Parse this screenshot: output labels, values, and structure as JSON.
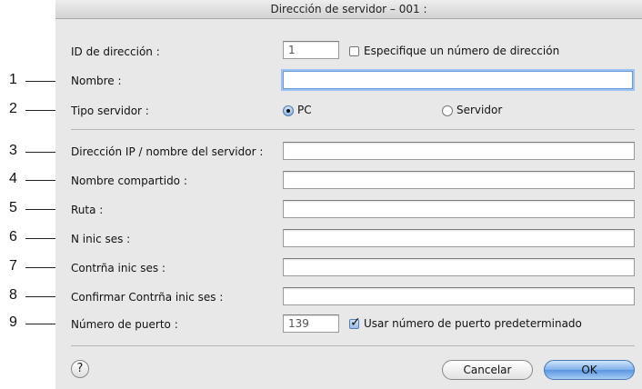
{
  "dialog": {
    "title": "Dirección de servidor – 001 :",
    "address_id": {
      "label": "ID de dirección :",
      "value": "1",
      "specify_checkbox_label": "Especifique un número de dirección",
      "specify_checked": false
    },
    "name": {
      "label": "Nombre :",
      "value": ""
    },
    "server_type": {
      "label": "Tipo servidor :",
      "options": [
        "PC",
        "Servidor"
      ],
      "selected": "PC"
    },
    "ip_server_name": {
      "label": "Dirección IP / nombre del servidor :",
      "value": ""
    },
    "shared_name": {
      "label": "Nombre compartido :",
      "value": ""
    },
    "path": {
      "label": "Ruta :",
      "value": ""
    },
    "login_name": {
      "label": "N inic ses :",
      "value": ""
    },
    "login_password": {
      "label": "Contrña inic ses :",
      "value": ""
    },
    "confirm_password": {
      "label": "Confirmar Contrña inic ses :",
      "value": ""
    },
    "port": {
      "label": "Número de puerto :",
      "value": "139",
      "default_checkbox_label": "Usar número de puerto predeterminado",
      "default_checked": true
    },
    "buttons": {
      "help": "?",
      "cancel": "Cancelar",
      "ok": "OK"
    }
  },
  "callouts": [
    "1",
    "2",
    "3",
    "4",
    "5",
    "6",
    "7",
    "8",
    "9"
  ]
}
